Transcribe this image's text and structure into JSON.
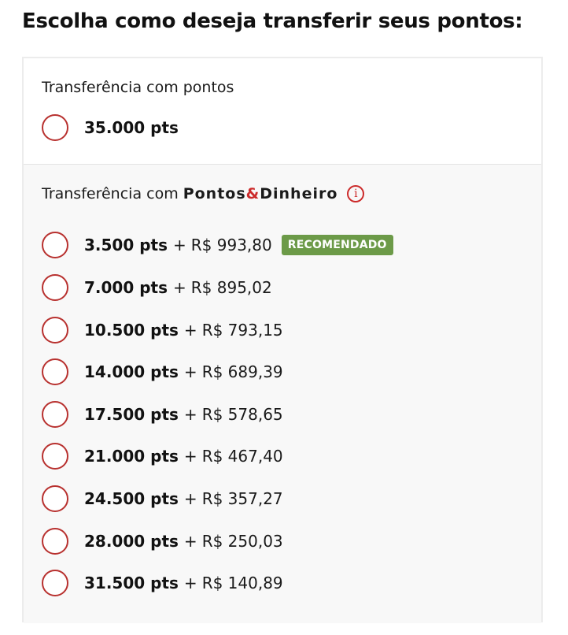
{
  "title": "Escolha como deseja transferir seus pontos:",
  "points_section": {
    "heading": "Transferência com pontos",
    "option": {
      "points": "35.000 pts"
    }
  },
  "mixed_section": {
    "heading_prefix": "Transferência com",
    "brand_part1": "Pontos",
    "brand_amp": "&",
    "brand_part2": "Dinheiro",
    "info_glyph": "i",
    "plus": "+",
    "badge": "RECOMENDADO",
    "options": [
      {
        "points": "3.500 pts",
        "money": "R$ 993,80"
      },
      {
        "points": "7.000 pts",
        "money": "R$ 895,02"
      },
      {
        "points": "10.500 pts",
        "money": "R$ 793,15"
      },
      {
        "points": "14.000 pts",
        "money": "R$ 689,39"
      },
      {
        "points": "17.500 pts",
        "money": "R$ 578,65"
      },
      {
        "points": "21.000 pts",
        "money": "R$ 467,40"
      },
      {
        "points": "24.500 pts",
        "money": "R$ 357,27"
      },
      {
        "points": "28.000 pts",
        "money": "R$ 250,03"
      },
      {
        "points": "31.500 pts",
        "money": "R$ 140,89"
      }
    ]
  },
  "colors": {
    "accent_red": "#b8312f",
    "badge_green": "#6c9a48"
  }
}
